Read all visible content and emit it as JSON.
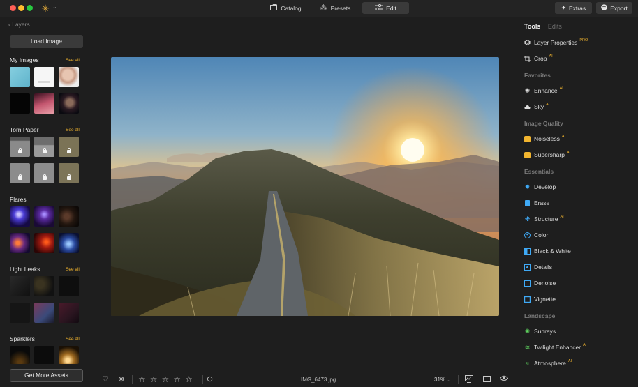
{
  "topbar": {
    "tabs": [
      {
        "label": "Catalog",
        "icon": "catalog-icon"
      },
      {
        "label": "Presets",
        "icon": "presets-icon"
      },
      {
        "label": "Edit",
        "icon": "sliders-icon"
      }
    ],
    "active_tab": "Edit",
    "extras_label": "Extras",
    "export_label": "Export"
  },
  "left_panel": {
    "back_label": "Layers",
    "load_image_label": "Load Image",
    "see_all_label": "See all",
    "sections": [
      {
        "title": "My Images",
        "see_all": true
      },
      {
        "title": "Torn Paper",
        "see_all": true
      },
      {
        "title": "Flares",
        "see_all": false
      },
      {
        "title": "Light Leaks",
        "see_all": true
      },
      {
        "title": "Sparklers",
        "see_all": true
      }
    ],
    "get_more_label": "Get More Assets"
  },
  "bottom_bar": {
    "filename": "IMG_6473.jpg",
    "zoom": "31%",
    "rating_stars": 5,
    "rating_value": 0
  },
  "right_panel": {
    "tabs": {
      "tools": "Tools",
      "edits": "Edits"
    },
    "badge_pro": "PRO",
    "badge_ai": "AI",
    "top_tools": [
      {
        "label": "Layer Properties",
        "badge": "PRO",
        "icon": "layers-icon"
      },
      {
        "label": "Crop",
        "badge": "AI",
        "icon": "crop-icon"
      }
    ],
    "groups": [
      {
        "title": "Favorites",
        "tools": [
          {
            "label": "Enhance",
            "badge": "AI",
            "icon": "enhance-icon"
          },
          {
            "label": "Sky",
            "badge": "AI",
            "icon": "cloud-icon"
          }
        ]
      },
      {
        "title": "Image Quality",
        "tools": [
          {
            "label": "Noiseless",
            "badge": "AI",
            "icon": "noiseless-icon"
          },
          {
            "label": "Supersharp",
            "badge": "AI",
            "icon": "supersharp-icon"
          }
        ]
      },
      {
        "title": "Essentials",
        "tools": [
          {
            "label": "Develop",
            "badge": "",
            "icon": "develop-icon"
          },
          {
            "label": "Erase",
            "badge": "",
            "icon": "erase-icon"
          },
          {
            "label": "Structure",
            "badge": "AI",
            "icon": "structure-icon"
          },
          {
            "label": "Color",
            "badge": "",
            "icon": "color-icon"
          },
          {
            "label": "Black & White",
            "badge": "",
            "icon": "black-white-icon"
          },
          {
            "label": "Details",
            "badge": "",
            "icon": "details-icon"
          },
          {
            "label": "Denoise",
            "badge": "",
            "icon": "denoise-icon"
          },
          {
            "label": "Vignette",
            "badge": "",
            "icon": "vignette-icon"
          }
        ]
      },
      {
        "title": "Landscape",
        "tools": [
          {
            "label": "Sunrays",
            "badge": "",
            "icon": "sunrays-icon"
          },
          {
            "label": "Twilight Enhancer",
            "badge": "AI",
            "icon": "twilight-icon"
          },
          {
            "label": "Atmosphere",
            "badge": "AI",
            "icon": "atmosphere-icon"
          }
        ]
      }
    ]
  },
  "colors": {
    "accent": "#f2b52f",
    "panel_bg": "#1e1e1e",
    "button_bg": "#3a3a3a"
  }
}
